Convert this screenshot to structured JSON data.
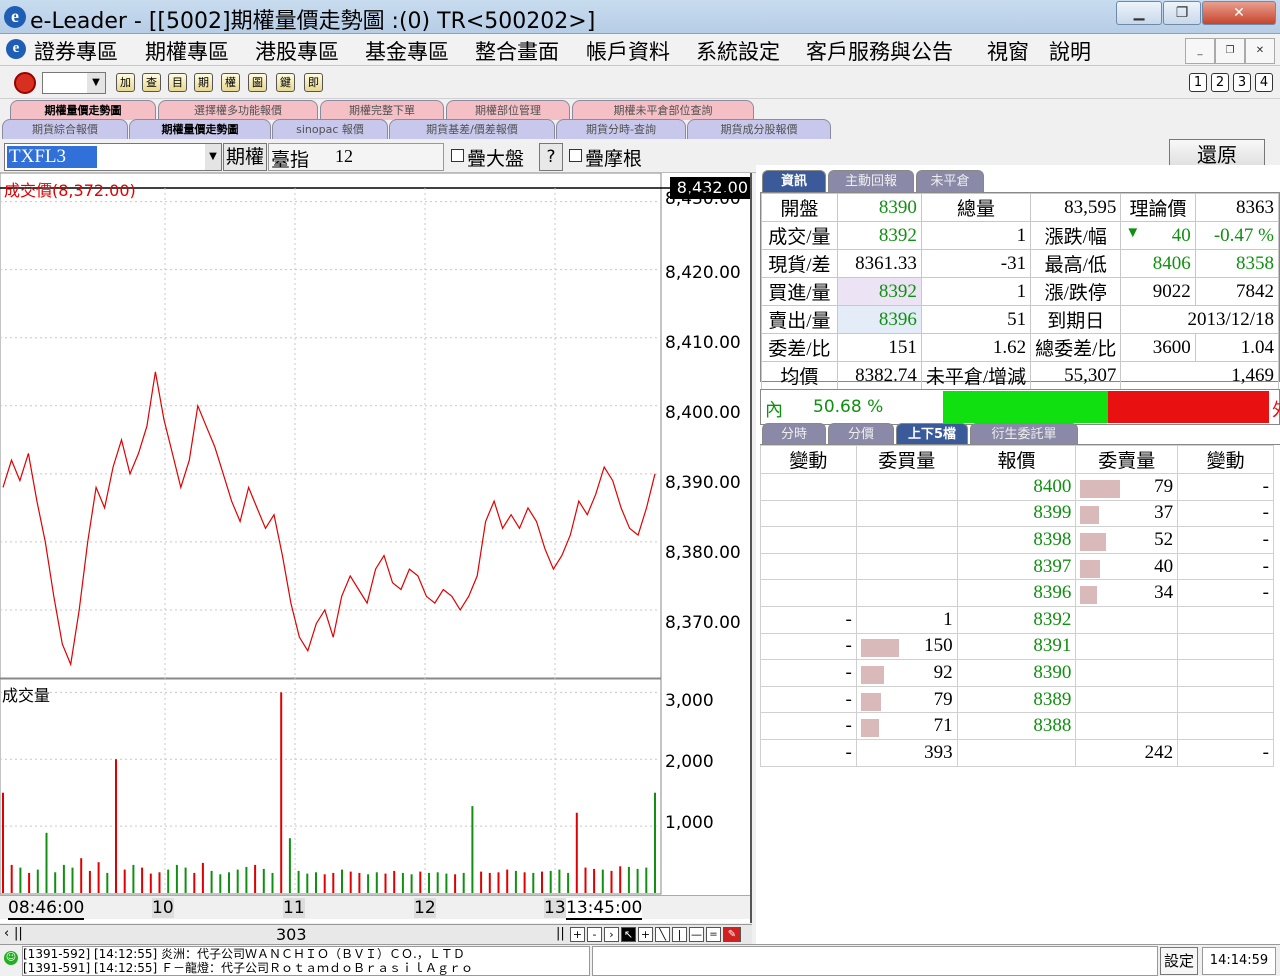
{
  "window": {
    "title": "e-Leader - [[5002]期權量價走勢圖 :(0) TR<500202>]",
    "app_letter": "e"
  },
  "menu": [
    "證券專區",
    "期權專區",
    "港股專區",
    "基金專區",
    "整合畫面",
    "帳戶資料",
    "系統設定",
    "客戶服務與公告",
    "視窗",
    "說明"
  ],
  "toolbar": {
    "icons": [
      "加",
      "查",
      "目",
      "期",
      "權",
      "圖",
      "鍵",
      "即"
    ],
    "pages": [
      "1",
      "2",
      "3",
      "4"
    ]
  },
  "tabs_row1": [
    {
      "label": "期權量價走勢圖",
      "active": true
    },
    {
      "label": "選擇權多功能報價",
      "active": false
    },
    {
      "label": "期權完整下單",
      "active": false
    },
    {
      "label": "期權部位管理",
      "active": false
    },
    {
      "label": "期權未平倉部位查詢",
      "active": false
    }
  ],
  "tabs_row2": [
    {
      "label": "期貨綜合報價",
      "active": false
    },
    {
      "label": "期權量價走勢圖",
      "active": true
    },
    {
      "label": "sinopac 報價",
      "active": false
    },
    {
      "label": "期貨基差/價差報價",
      "active": false
    },
    {
      "label": "期貨分時-查詢",
      "active": false
    },
    {
      "label": "期貨成分股報價",
      "active": false
    }
  ],
  "controls": {
    "symbol": "TXFL3",
    "btn_option": "期權",
    "index_label": "臺指",
    "index_value": "12",
    "overlay_market": "疊大盤",
    "help": "?",
    "overlay_candle": "疊摩根",
    "restore": "還原"
  },
  "chart": {
    "price_label": "成交價(8,372.00)",
    "last_price_tag": "8,432.00",
    "volume_label": "成交量",
    "time_labels": [
      "08:46:00",
      "10",
      "11",
      "12",
      "13",
      "13:45:00"
    ],
    "scroll_value": "303",
    "colors": {
      "price_line": "#e00000",
      "volume_up": "#e00000",
      "volume_down": "#109010",
      "grid": "#c8c8c8"
    }
  },
  "chart_data": {
    "type": "line",
    "title": "",
    "series": [
      {
        "name": "成交價",
        "values": [
          8388,
          8392,
          8389,
          8393,
          8386,
          8380,
          8372,
          8365,
          8362,
          8370,
          8380,
          8388,
          8385,
          8391,
          8395,
          8390,
          8393,
          8397,
          8405,
          8398,
          8393,
          8388,
          8392,
          8400,
          8397,
          8394,
          8390,
          8386,
          8383,
          8388,
          8385,
          8382,
          8384,
          8378,
          8371,
          8366,
          8364,
          8368,
          8370,
          8366,
          8372,
          8375,
          8373,
          8371,
          8376,
          8378,
          8374,
          8373,
          8376,
          8375,
          8372,
          8371,
          8373,
          8372,
          8370,
          8372,
          8375,
          8383,
          8386,
          8382,
          8384,
          8382,
          8385,
          8383,
          8379,
          8376,
          8378,
          8381,
          8386,
          8384,
          8387,
          8391,
          8389,
          8385,
          8382,
          8381,
          8385,
          8390
        ],
        "ylim": [
          8360,
          8432
        ]
      },
      {
        "name": "成交量",
        "values": [
          1500,
          420,
          380,
          300,
          350,
          900,
          310,
          420,
          380,
          520,
          330,
          460,
          300,
          2000,
          350,
          420,
          380,
          290,
          310,
          350,
          420,
          380,
          300,
          450,
          330,
          280,
          310,
          350,
          390,
          420,
          360,
          300,
          3000,
          820,
          330,
          290,
          310,
          280,
          300,
          350,
          320,
          300,
          280,
          310,
          290,
          330,
          300,
          280,
          320,
          300,
          310,
          290,
          280,
          300,
          1300,
          320,
          300,
          310,
          350,
          330,
          310,
          300,
          320,
          330,
          350,
          300,
          1200,
          380,
          360,
          350,
          330,
          400,
          390,
          360,
          380,
          1500
        ],
        "ylim": [
          0,
          3200
        ]
      }
    ],
    "ylabel": "",
    "y_ticks_price": [
      "8,430.00",
      "8,420.00",
      "8,410.00",
      "8,400.00",
      "8,390.00",
      "8,380.00",
      "8,370.00"
    ],
    "y_ticks_volume": [
      "3,000",
      "2,000",
      "1,000"
    ]
  },
  "right_tabs": [
    {
      "label": "資訊",
      "active": true
    },
    {
      "label": "主動回報",
      "active": false
    },
    {
      "label": "未平倉",
      "active": false
    }
  ],
  "info_rows": [
    [
      "開盤",
      "8390",
      "總量",
      "83,595",
      "理論價",
      "8363"
    ],
    [
      "成交/量",
      "8392",
      "1",
      "漲跌/幅",
      "40",
      "-0.47 %"
    ],
    [
      "現貨/差",
      "8361.33",
      "-31",
      "最高/低",
      "8406",
      "8358"
    ],
    [
      "買進/量",
      "8392",
      "1",
      "漲/跌停",
      "9022",
      "7842"
    ],
    [
      "賣出/量",
      "8396",
      "51",
      "到期日",
      "2013/12/18",
      ""
    ],
    [
      "委差/比",
      "151",
      "1.62",
      "總委差/比",
      "3600",
      "1.04"
    ],
    [
      "均價",
      "8382.74",
      "未平倉/增減",
      "55,307",
      "1,469",
      ""
    ]
  ],
  "ratio": {
    "label": "內",
    "value": "50.68 %",
    "right_label": "外",
    "inside_fraction": 0.5068
  },
  "lower_tabs": [
    {
      "label": "分時",
      "active": false
    },
    {
      "label": "分價",
      "active": false
    },
    {
      "label": "上下5檔",
      "active": true
    },
    {
      "label": "衍生委託單",
      "active": false
    }
  ],
  "quote_headers": [
    "變動",
    "委買量",
    "報價",
    "委賣量",
    "變動"
  ],
  "asks": [
    {
      "price": "8400",
      "vol": "79",
      "chg": "-"
    },
    {
      "price": "8399",
      "vol": "37",
      "chg": "-"
    },
    {
      "price": "8398",
      "vol": "52",
      "chg": "-"
    },
    {
      "price": "8397",
      "vol": "40",
      "chg": "-"
    },
    {
      "price": "8396",
      "vol": "34",
      "chg": "-"
    }
  ],
  "bids": [
    {
      "price": "8392",
      "vol": "1",
      "chg": "-"
    },
    {
      "price": "8391",
      "vol": "150",
      "chg": "-"
    },
    {
      "price": "8390",
      "vol": "92",
      "chg": "-"
    },
    {
      "price": "8389",
      "vol": "79",
      "chg": "-"
    },
    {
      "price": "8388",
      "vol": "71",
      "chg": "-"
    }
  ],
  "totals": {
    "chg_left": "-",
    "bid_total": "393",
    "ask_total": "242",
    "chg_right": "-"
  },
  "status": {
    "lines": [
      "[1391-592] [14:12:55] 炎洲：代子公司ＷＡＮＣＨＩＯ（ＢＶＩ）ＣＯ.，ＬＴＤ",
      "[1391-591] [14:12:55] Ｆ－龍燈：代子公司ＲｏｔａｍｄｏＢｒａｓｉｌＡｇｒｏ"
    ],
    "settings": "設定",
    "clock": "14:14:59"
  }
}
